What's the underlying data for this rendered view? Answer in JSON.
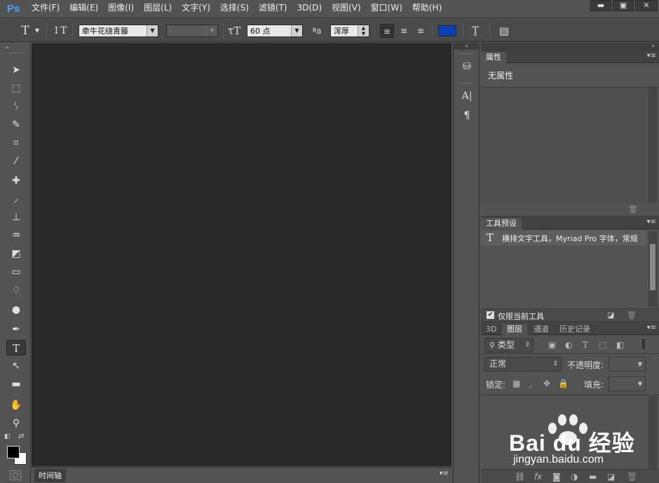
{
  "app": {
    "logo": "Ps"
  },
  "menu": [
    "文件(F)",
    "编辑(E)",
    "图像(I)",
    "图层(L)",
    "文字(Y)",
    "选择(S)",
    "滤镜(T)",
    "3D(D)",
    "视图(V)",
    "窗口(W)",
    "帮助(H)"
  ],
  "window_controls": {
    "minimize": "▬",
    "restore": "▣",
    "close": "✕"
  },
  "options": {
    "font_family": "牵牛花绕青藤",
    "font_style": "-",
    "font_size": "60 点",
    "aa_label": "ªa",
    "antialias": "浑厚",
    "text_color": "#0a3fb8"
  },
  "timeline": {
    "label": "时间轴"
  },
  "properties": {
    "tab": "属性",
    "empty_text": "无属性"
  },
  "tool_presets": {
    "tab": "工具预设",
    "item": "横排文字工具，Myriad Pro 字体，常规",
    "checkbox_label": "仅限当前工具",
    "checkbox_checked": true
  },
  "layers": {
    "tabs": [
      "3D",
      "图层",
      "通道",
      "历史记录"
    ],
    "active_tab": "图层",
    "filter_kind": "类型",
    "blend_mode": "正常",
    "opacity_label": "不透明度:",
    "lock_label": "锁定:",
    "fill_label": "填充:"
  },
  "watermark": {
    "brand": "Bai du 经验",
    "url": "jingyan.baidu.com"
  }
}
